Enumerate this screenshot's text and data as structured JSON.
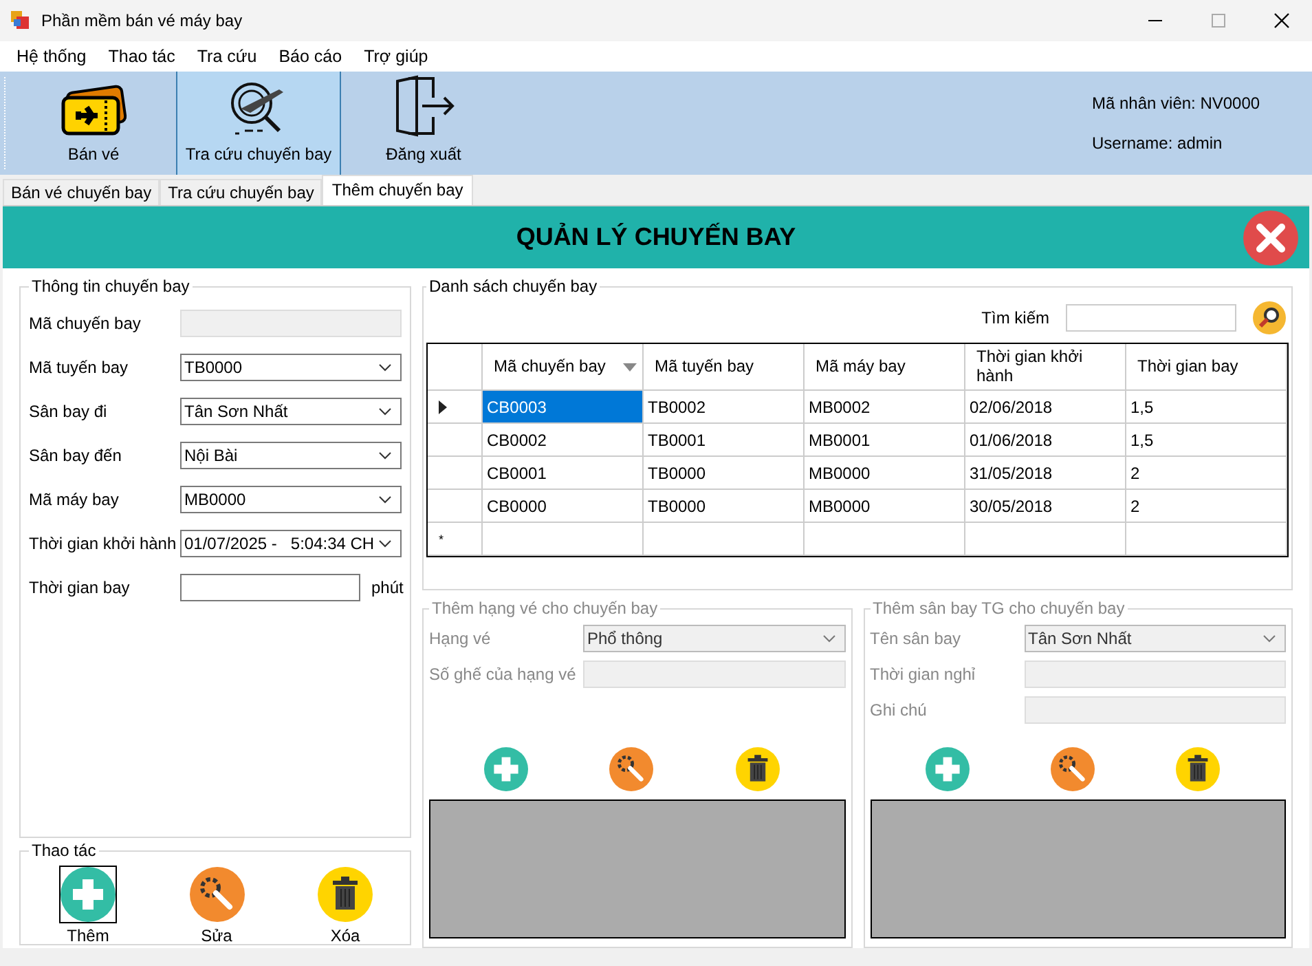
{
  "window": {
    "title": "Phần mềm bán vé máy bay"
  },
  "menu": [
    "Hệ thống",
    "Thao tác",
    "Tra cứu",
    "Báo cáo",
    "Trợ giúp"
  ],
  "toolbar": {
    "buttons": [
      {
        "label": "Bán vé",
        "kind": "ticket",
        "selected": false
      },
      {
        "label": "Tra cứu chuyến bay",
        "kind": "search",
        "selected": true
      },
      {
        "label": "Đăng xuất",
        "kind": "logout",
        "selected": false
      }
    ],
    "user_info": [
      "Mã nhân viên: NV0000",
      "Username: admin"
    ]
  },
  "tabs": [
    {
      "label": "Bán vé chuyến bay",
      "selected": false
    },
    {
      "label": "Tra cứu chuyến bay",
      "selected": false
    },
    {
      "label": "Thêm chuyến bay",
      "selected": true
    }
  ],
  "header": {
    "title": "QUẢN LÝ CHUYẾN BAY"
  },
  "flight_info": {
    "title": "Thông tin chuyến bay",
    "fields": [
      {
        "label": "Mã chuyến bay",
        "kind": "text",
        "disabled": true
      },
      {
        "label": "Mã tuyến bay",
        "kind": "combo",
        "value": "TB0000"
      },
      {
        "label": "Sân bay đi",
        "kind": "combo",
        "value": "Tân Sơn Nhất"
      },
      {
        "label": "Sân bay đến",
        "kind": "combo",
        "value": "Nội Bài"
      },
      {
        "label": "Mã máy bay",
        "kind": "combo",
        "value": "MB0000"
      },
      {
        "label": "Thời gian khởi hành",
        "kind": "datetime",
        "value": "01/07/2025 -   5:04:34 CH"
      },
      {
        "label": "Thời gian bay",
        "kind": "text",
        "disabled": false,
        "suffix": "phút"
      }
    ]
  },
  "actions": {
    "title": "Thao tác",
    "buttons": [
      {
        "label": "Thêm",
        "kind": "add",
        "focused": true
      },
      {
        "label": "Sửa",
        "kind": "edit",
        "focused": false
      },
      {
        "label": "Xóa",
        "kind": "delete",
        "focused": false
      }
    ]
  },
  "flight_list": {
    "title": "Danh sách chuyến bay",
    "search_label": "Tìm kiếm",
    "columns": [
      {
        "label": "Mã chuyến bay",
        "sorted": true
      },
      {
        "label": "Mã tuyến bay",
        "sorted": false
      },
      {
        "label": "Mã máy bay",
        "sorted": false
      },
      {
        "label": "Thời gian khởi hành",
        "sorted": false
      },
      {
        "label": "Thời gian bay",
        "sorted": false
      }
    ],
    "rows": [
      {
        "cells": [
          "CB0003",
          "TB0002",
          "MB0002",
          "02/06/2018",
          "1,5"
        ],
        "selected": true
      },
      {
        "cells": [
          "CB0002",
          "TB0001",
          "MB0001",
          "01/06/2018",
          "1,5"
        ],
        "selected": false
      },
      {
        "cells": [
          "CB0001",
          "TB0000",
          "MB0000",
          "31/05/2018",
          "2"
        ],
        "selected": false
      },
      {
        "cells": [
          "CB0000",
          "TB0000",
          "MB0000",
          "30/05/2018",
          "2"
        ],
        "selected": false
      }
    ],
    "new_row_marker": "*"
  },
  "ticket_class": {
    "title": "Thêm hạng vé cho chuyến bay",
    "disabled": true,
    "fields": [
      {
        "label": "Hạng vé",
        "kind": "combo",
        "value": "Phổ thông"
      },
      {
        "label": "Số ghế của hạng vé",
        "kind": "text"
      }
    ],
    "buttons": [
      {
        "kind": "add"
      },
      {
        "kind": "edit"
      },
      {
        "kind": "delete"
      }
    ]
  },
  "stopover": {
    "title": "Thêm sân bay TG cho chuyến bay",
    "disabled": true,
    "fields": [
      {
        "label": "Tên sân bay",
        "kind": "combo",
        "value": "Tân Sơn Nhất"
      },
      {
        "label": "Thời gian nghỉ",
        "kind": "text"
      },
      {
        "label": "Ghi chú",
        "kind": "text"
      }
    ],
    "buttons": [
      {
        "kind": "add"
      },
      {
        "kind": "edit"
      },
      {
        "kind": "delete"
      }
    ]
  }
}
